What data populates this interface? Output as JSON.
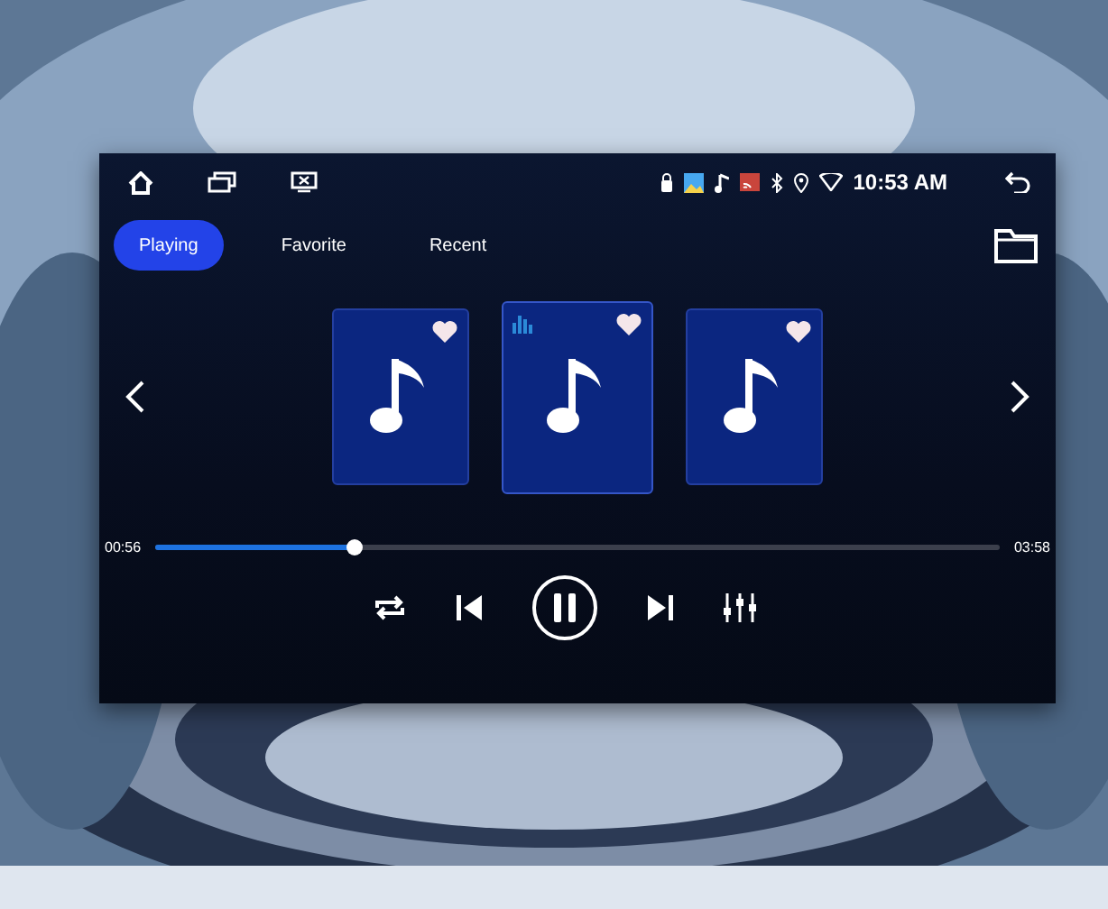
{
  "status_bar": {
    "time": "10:53 AM"
  },
  "tabs": [
    {
      "label": "Playing",
      "selected": true
    },
    {
      "label": "Favorite",
      "selected": false
    },
    {
      "label": "Recent",
      "selected": false
    }
  ],
  "tracks": [
    {
      "selected": false,
      "liked": true,
      "playing": false
    },
    {
      "selected": true,
      "liked": true,
      "playing": true
    },
    {
      "selected": false,
      "liked": true,
      "playing": false
    }
  ],
  "progress": {
    "elapsed": "00:56",
    "total": "03:58",
    "level": 0.235
  },
  "player": {
    "playing": true
  }
}
